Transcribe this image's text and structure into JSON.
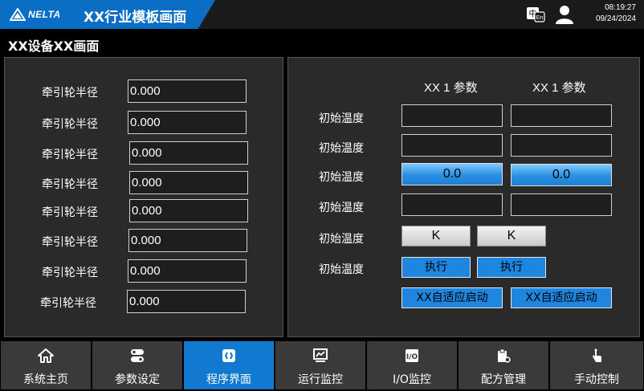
{
  "header": {
    "logo_text": "NELTA",
    "app_title": "XX行业模板画面",
    "time": "08:19:27",
    "date": "09/24/2024",
    "lang_icon": "language-icon",
    "user_icon": "user-icon"
  },
  "page_title": "XX设备XX画面",
  "left_rows": [
    {
      "label": "牵引轮半径",
      "value": "0.000"
    },
    {
      "label": "牵引轮半径",
      "value": "0.000"
    },
    {
      "label": "牵引轮半径",
      "value": "0.000"
    },
    {
      "label": "牵引轮半径",
      "value": "0.000"
    },
    {
      "label": "牵引轮半径",
      "value": "0.000"
    },
    {
      "label": "牵引轮半径",
      "value": "0.000"
    },
    {
      "label": "牵引轮半径",
      "value": "0.000"
    },
    {
      "label": "牵引轮半径",
      "value": "0.000"
    }
  ],
  "right": {
    "col1_header": "XX 1 参数",
    "col2_header": "XX 1 参数",
    "row_labels": [
      "初始温度",
      "初始温度",
      "初始温度",
      "初始温度",
      "初始温度",
      "初始温度"
    ],
    "value_col1": "0.0",
    "value_col2": "0.0",
    "k_label": "K",
    "execute_label": "执行",
    "auto_start_label": "XX自适应启动"
  },
  "nav": [
    {
      "label": "系统主页",
      "icon": "home-icon",
      "active": false
    },
    {
      "label": "参数设定",
      "icon": "parameter-icon",
      "active": false
    },
    {
      "label": "程序界面",
      "icon": "program-icon",
      "active": true
    },
    {
      "label": "运行监控",
      "icon": "monitor-icon",
      "active": false
    },
    {
      "label": "I/O监控",
      "icon": "io-icon",
      "active": false
    },
    {
      "label": "配方管理",
      "icon": "recipe-icon",
      "active": false
    },
    {
      "label": "手动控制",
      "icon": "hand-icon",
      "active": false
    }
  ],
  "colors": {
    "accent": "#1279d0",
    "panel": "#2a2a2a",
    "background": "#000000"
  }
}
